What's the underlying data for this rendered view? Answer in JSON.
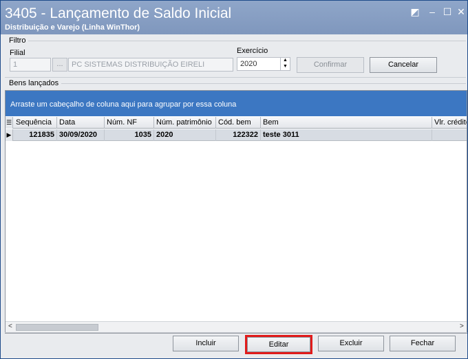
{
  "window": {
    "title": "3405 - Lançamento de Saldo Inicial",
    "subtitle": "Distribuição e Varejo (Linha WinThor)",
    "controls": {
      "restore": "◩",
      "minimize": "–",
      "maximize": "☐",
      "close": "✕"
    }
  },
  "filtro": {
    "group_label": "Filtro",
    "filial_label": "Filial",
    "filial_value": "1",
    "filial_lookup": "...",
    "empresa_value": "PC SISTEMAS DISTRIBUIÇÃO  EIRELI",
    "exercicio_label": "Exercício",
    "exercicio_value": "2020",
    "confirmar_label": "Confirmar",
    "cancelar_label": "Cancelar"
  },
  "bens": {
    "group_label": "Bens lançados",
    "groupbar_hint": "Arraste um cabeçalho de coluna aqui para agrupar por essa coluna",
    "columns": [
      "Sequência",
      "Data",
      "Núm. NF",
      "Núm. patrimônio",
      "Cód. bem",
      "Bem",
      "Vlr. crédito"
    ],
    "rows": [
      [
        "121835",
        "30/09/2020",
        "1035",
        "2020",
        "122322",
        "teste 3011",
        ""
      ]
    ]
  },
  "actions": {
    "incluir": "Incluir",
    "editar": "Editar",
    "excluir": "Excluir",
    "fechar": "Fechar"
  },
  "colors": {
    "accent": "#3c77c2",
    "highlight": "#e11b1b",
    "titlebar": "#8fa6c9"
  }
}
